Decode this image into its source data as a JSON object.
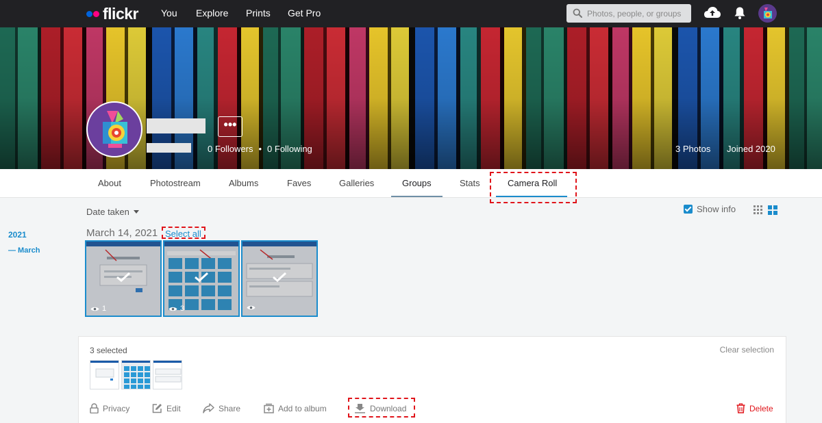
{
  "nav": {
    "logo_text": "flickr",
    "links": [
      "You",
      "Explore",
      "Prints",
      "Get Pro"
    ],
    "search_placeholder": "Photos, people, or groups"
  },
  "profile": {
    "more_label": "•••",
    "followers": "0 Followers",
    "following": "0 Following",
    "separator": "•",
    "photos_count": "3 Photos",
    "joined": "Joined 2020"
  },
  "tabs": [
    "About",
    "Photostream",
    "Albums",
    "Faves",
    "Galleries",
    "Groups",
    "Stats",
    "Camera Roll"
  ],
  "toolbar": {
    "sort_label": "Date taken",
    "show_info_label": "Show info",
    "show_info_checked": true
  },
  "timeline": {
    "year": "2021",
    "month": "— March"
  },
  "day_group": {
    "date": "March 14, 2021",
    "select_all": "Select all",
    "photos": [
      {
        "views": "1",
        "selected": true
      },
      {
        "views": "3",
        "selected": true
      },
      {
        "views": "",
        "selected": true
      }
    ]
  },
  "selection": {
    "count_label": "3 selected",
    "clear_label": "Clear selection",
    "actions": {
      "privacy": "Privacy",
      "edit": "Edit",
      "share": "Share",
      "add_to_album": "Add to album",
      "download": "Download",
      "delete": "Delete"
    }
  },
  "colors": {
    "nav_bg": "#212124",
    "accent_blue": "#1a8ccc",
    "highlight_red": "#e0141a",
    "flickr_blue": "#0063dc",
    "flickr_pink": "#ff0084"
  }
}
